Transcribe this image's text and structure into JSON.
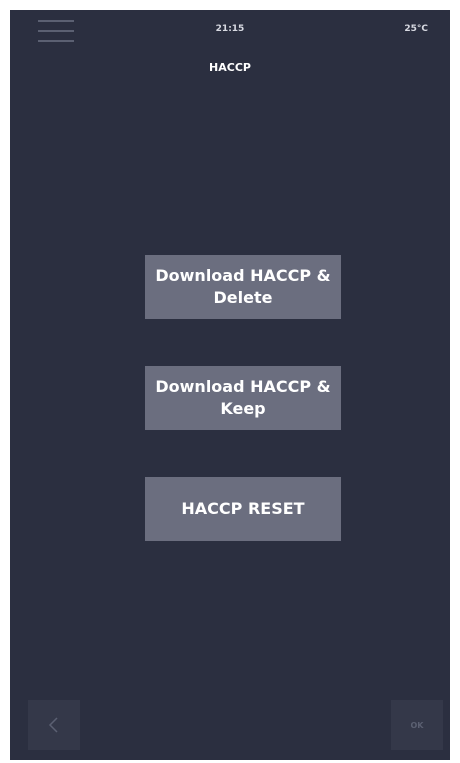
{
  "status_bar": {
    "time": "21:15",
    "temperature": "25°C"
  },
  "header": {
    "title": "HACCP"
  },
  "actions": {
    "download_delete": "Download HACCP & Delete",
    "download_keep": "Download HACCP & Keep",
    "reset": "HACCP RESET"
  },
  "footer": {
    "ok_label": "OK"
  },
  "icons": {
    "menu": "menu-icon",
    "back": "chevron-left-icon"
  },
  "colors": {
    "background": "#2b2f40",
    "button": "#6b6e7f",
    "footer_button": "#343849",
    "dim": "#5b6072"
  }
}
